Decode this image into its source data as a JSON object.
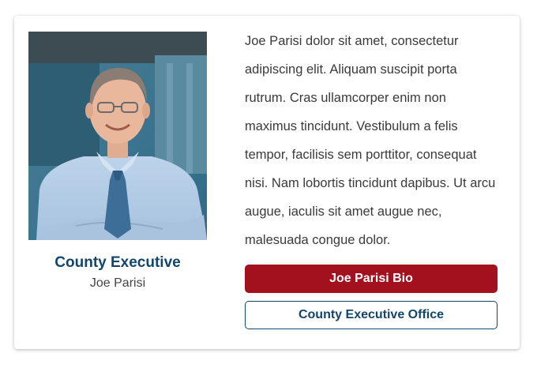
{
  "profile": {
    "photo_alt": "Portrait of Joe Parisi",
    "title": "County Executive",
    "name": "Joe Parisi",
    "bio": "Joe Parisi dolor sit amet, consectetur adipiscing elit. Aliquam suscipit porta rutrum. Cras ullamcorper enim non maximus tincidunt. Vestibulum a felis tempor, facilisis sem porttitor, consequat nisi. Nam lobortis tincidunt dapibus. Ut arcu augue, iaculis sit amet augue nec, malesuada congue dolor."
  },
  "buttons": {
    "primary_label": "Joe Parisi Bio",
    "secondary_label": "County Executive Office"
  },
  "colors": {
    "title": "#12456b",
    "primary_button": "#a3101e",
    "secondary_border": "#12456b"
  }
}
